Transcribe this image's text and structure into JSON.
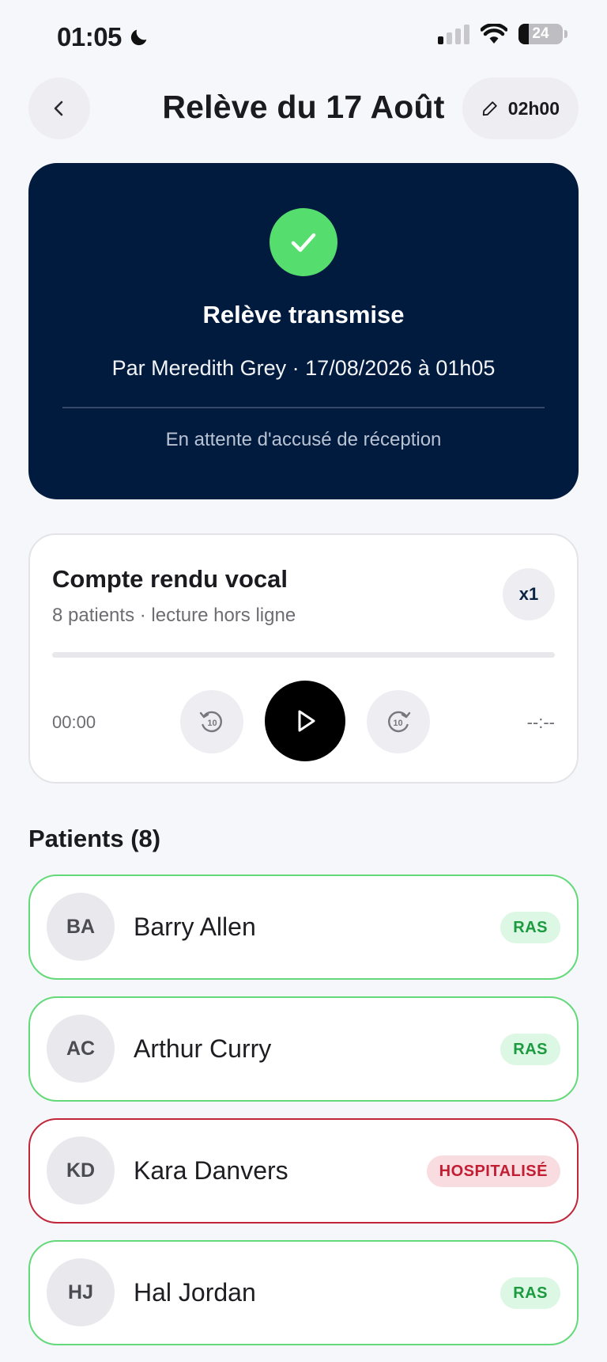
{
  "status_bar": {
    "time": "01:05",
    "battery": "24"
  },
  "header": {
    "title": "Relève du 17 Août",
    "duration_label": "02h00"
  },
  "hero": {
    "title": "Relève transmise",
    "subtitle": "Par Meredith Grey · 17/08/2026 à 01h05",
    "note": "En attente d'accusé de réception",
    "accent": "#55dd6e",
    "background": "#011b3f"
  },
  "audio": {
    "title": "Compte rendu vocal",
    "subtitle": "8 patients · lecture hors ligne",
    "speed": "x1",
    "current_time": "00:00",
    "total_time": "--:--",
    "progress": 0,
    "skip_back_label": "10",
    "skip_forward_label": "10"
  },
  "patients": {
    "title": "Patients (8)",
    "items": [
      {
        "initials": "BA",
        "name": "Barry Allen",
        "status": "RAS",
        "state": "ok"
      },
      {
        "initials": "AC",
        "name": "Arthur Curry",
        "status": "RAS",
        "state": "ok"
      },
      {
        "initials": "KD",
        "name": "Kara Danvers",
        "status": "HOSPITALISÉ",
        "state": "alert"
      },
      {
        "initials": "HJ",
        "name": "Hal Jordan",
        "status": "RAS",
        "state": "ok"
      }
    ]
  }
}
